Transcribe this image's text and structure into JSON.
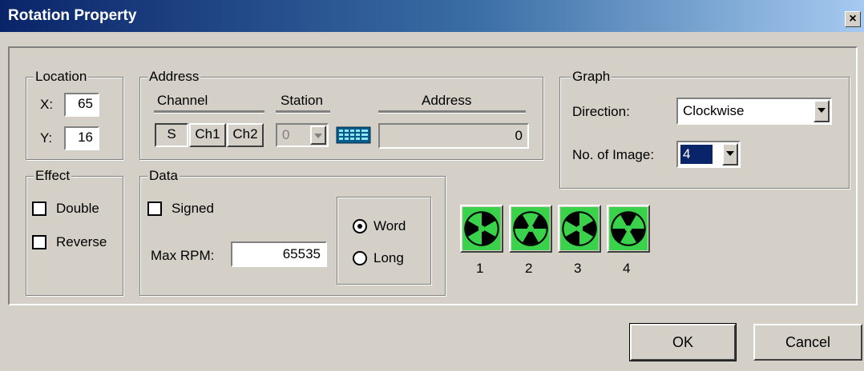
{
  "window": {
    "title": "Rotation Property",
    "close_label": "×"
  },
  "location": {
    "legend": "Location",
    "x_label": "X:",
    "x_value": "65",
    "y_label": "Y:",
    "y_value": "16"
  },
  "address": {
    "legend": "Address",
    "channel_header": "Channel",
    "station_header": "Station",
    "address_header": "Address",
    "channel_buttons": [
      "S",
      "Ch1",
      "Ch2"
    ],
    "station_value": "0",
    "address_value": "0",
    "keypad_icon": "keypad-icon"
  },
  "effect": {
    "legend": "Effect",
    "double_label": "Double",
    "reverse_label": "Reverse"
  },
  "data": {
    "legend": "Data",
    "signed_label": "Signed",
    "max_rpm_label": "Max RPM:",
    "max_rpm_value": "65535",
    "word_label": "Word",
    "long_label": "Long",
    "selected_format": "Word"
  },
  "graph": {
    "legend": "Graph",
    "direction_label": "Direction:",
    "direction_value": "Clockwise",
    "images_label": "No. of Image:",
    "images_value": "4"
  },
  "image_previews": {
    "labels": [
      "1",
      "2",
      "3",
      "4"
    ],
    "icon": "fan-icon",
    "color": "#39d24a"
  },
  "buttons": {
    "ok": "OK",
    "cancel": "Cancel"
  }
}
